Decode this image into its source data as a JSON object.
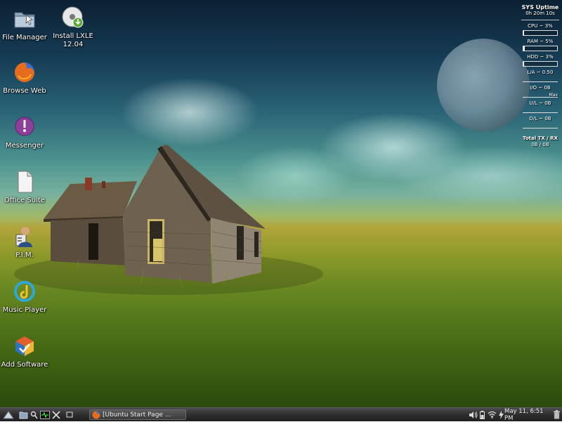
{
  "desktop": {
    "icons": [
      {
        "label": "File Manager",
        "icon": "folder-icon"
      },
      {
        "label": "Install LXLE\n12.04",
        "icon": "install-disc-icon"
      },
      {
        "label": "Browse Web",
        "icon": "firefox-icon"
      },
      {
        "label": "Messenger",
        "icon": "messenger-icon"
      },
      {
        "label": "Office Suite",
        "icon": "document-icon"
      },
      {
        "label": "P.I.M.",
        "icon": "contact-icon"
      },
      {
        "label": "Music Player",
        "icon": "music-player-icon"
      },
      {
        "label": "Add Software",
        "icon": "software-center-icon"
      }
    ]
  },
  "conky": {
    "title": "SYS Uptime",
    "uptime": "0h 20m 10s",
    "cpu": "CPU ~ 3%",
    "cpu_level": 0.03,
    "ram": "RAM ~ 5%",
    "ram_level": 0.05,
    "hdd": "HDD ~ 3%",
    "hdd_level": 0.03,
    "la": "L/A ~ 0.50",
    "io": "I/O ~ 0B",
    "max": "Max",
    "ul": "U/L ~ 0B",
    "dl": "D/L ~ 0B",
    "total_title": "Total TX / RX",
    "total_values": "0B / 0B"
  },
  "taskbar": {
    "window_title": "[Ubuntu Start Page ...",
    "clock": "May 11, 6:51 PM",
    "icons": [
      "lxde-menu-icon",
      "file-manager-icon",
      "search-icon",
      "terminal-icon",
      "tools-icon",
      "show-desktop-icon",
      "volume-icon",
      "battery-icon",
      "wifi-icon",
      "power-icon",
      "trash-icon"
    ]
  },
  "colors": {
    "taskbar": "#2e2e2e",
    "sky_top": "#0b2033",
    "grass": "#6c8a24"
  }
}
